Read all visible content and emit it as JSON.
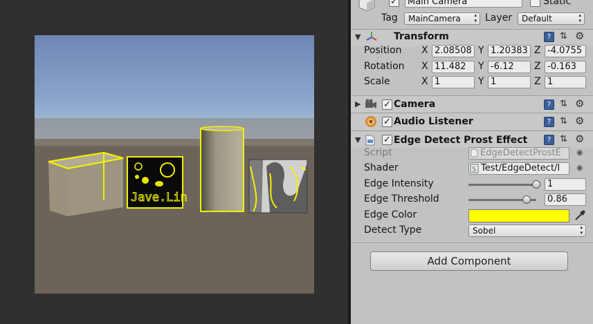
{
  "game_view": {
    "cube_texture_text": "Jave.Lin"
  },
  "header": {
    "object_name": "Main Camera",
    "static_label": "Static",
    "tag_label": "Tag",
    "tag_value": "MainCamera",
    "layer_label": "Layer",
    "layer_value": "Default"
  },
  "transform": {
    "title": "Transform",
    "position_label": "Position",
    "rotation_label": "Rotation",
    "scale_label": "Scale",
    "axis_x": "X",
    "axis_y": "Y",
    "axis_z": "Z",
    "position": {
      "x": "2.08508",
      "y": "1.20383",
      "z": "-4.0755"
    },
    "rotation": {
      "x": "11.482",
      "y": "-6.12",
      "z": "-0.163"
    },
    "scale": {
      "x": "1",
      "y": "1",
      "z": "1"
    }
  },
  "components": {
    "camera": "Camera",
    "audio_listener": "Audio Listener",
    "edge_detect": "Edge Detect Prost Effect"
  },
  "edge_detect": {
    "script_label": "Script",
    "script_value": "EdgeDetectProstE",
    "shader_label": "Shader",
    "shader_value": "Test/EdgeDetect/I",
    "intensity_label": "Edge Intensity",
    "intensity_value": "1",
    "intensity_level": 1.0,
    "threshold_label": "Edge Threshold",
    "threshold_value": "0.86",
    "threshold_level": 0.86,
    "color_label": "Edge Color",
    "color_value": "#ffff00",
    "detect_label": "Detect Type",
    "detect_value": "Sobel"
  },
  "add_component_label": "Add Component",
  "icons": {
    "help": "help-icon",
    "preset": "preset-icon",
    "gear": "gear-icon",
    "eyedropper": "eyedropper-icon"
  }
}
